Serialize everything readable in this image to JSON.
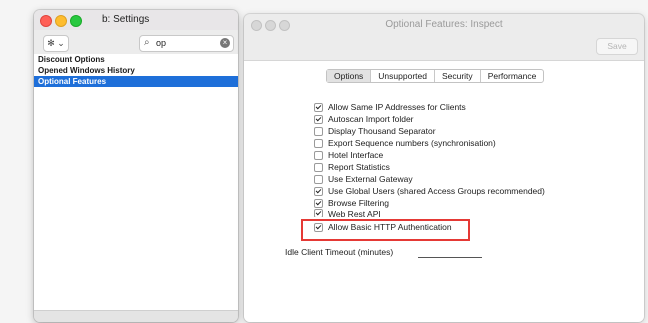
{
  "left_window": {
    "title": "b: Settings",
    "gear_label": "✻ ⌄",
    "search_icon": "⌕",
    "search_value": "op",
    "clear_icon": "×",
    "items": [
      {
        "label": "Discount Options",
        "selected": false
      },
      {
        "label": "Opened Windows History",
        "selected": false
      },
      {
        "label": "Optional Features",
        "selected": true
      }
    ]
  },
  "right_window": {
    "title": "Optional Features: Inspect",
    "save_label": "Save",
    "tabs": [
      {
        "label": "Options",
        "active": true
      },
      {
        "label": "Unsupported",
        "active": false
      },
      {
        "label": "Security",
        "active": false
      },
      {
        "label": "Performance",
        "active": false
      }
    ],
    "options": [
      {
        "label": "Allow Same IP Addresses for Clients",
        "checked": true
      },
      {
        "label": "Autoscan Import folder",
        "checked": true
      },
      {
        "label": "Display Thousand Separator",
        "checked": false
      },
      {
        "label": "Export Sequence numbers (synchronisation)",
        "checked": false
      },
      {
        "label": "Hotel Interface",
        "checked": false
      },
      {
        "label": "Report Statistics",
        "checked": false
      },
      {
        "label": "Use External Gateway",
        "checked": false
      },
      {
        "label": "Use Global Users (shared Access Groups recommended)",
        "checked": true
      },
      {
        "label": "Browse Filtering",
        "checked": true
      },
      {
        "label": "Web Rest API",
        "checked": true
      },
      {
        "label": "Allow Basic HTTP Authentication",
        "checked": true
      }
    ],
    "timeout_label": "Idle Client Timeout (minutes)",
    "timeout_value": ""
  },
  "colors": {
    "selection": "#1e6fd9",
    "highlight": "#e53935"
  }
}
